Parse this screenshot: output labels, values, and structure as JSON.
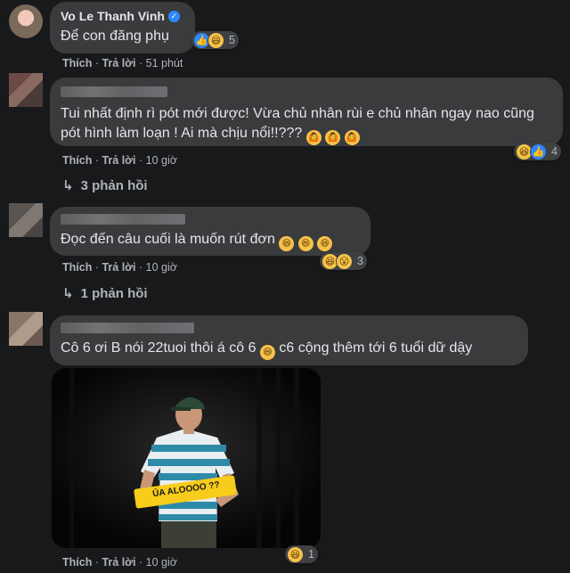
{
  "comments": [
    {
      "author": "Vo Le Thanh Vinh",
      "text": "Để con đăng phụ",
      "reaction_count": "5",
      "actions": {
        "like": "Thích",
        "reply": "Trả lời",
        "time": "51 phút"
      }
    },
    {
      "text": "Tui nhất định rì pót mới được! Vừa chủ nhân rùi e chủ nhân ngay nao cũng pót hình làm loạn ! Ai mà chịu nổi!!???",
      "reaction_count": "4",
      "actions": {
        "like": "Thích",
        "reply": "Trả lời",
        "time": "10 giờ"
      },
      "replies": "3 phản hồi"
    },
    {
      "text": "Đọc đến câu cuối là muốn rút đơn",
      "reaction_count": "3",
      "actions": {
        "like": "Thích",
        "reply": "Trả lời",
        "time": "10 giờ"
      },
      "replies": "1 phản hồi"
    },
    {
      "text_before": "Cô 6 ơi B nói 22tuoi thôi á cô 6",
      "text_after": "c6 cộng thêm tới 6 tuổi dữ dậy",
      "photo_sign": "ÚA ALOOOO ??",
      "reaction_count": "1",
      "actions": {
        "like": "Thích",
        "reply": "Trả lời",
        "time": "10 giờ"
      }
    }
  ],
  "icons": {
    "verified": "verified-badge-icon",
    "like": "like-reaction-icon",
    "haha": "haha-reaction-icon",
    "wow": "wow-reaction-icon",
    "reply_arrow": "reply-arrow-icon"
  },
  "colors": {
    "background": "#18191a",
    "bubble": "#3a3b3c",
    "text": "#e4e6eb",
    "muted": "#b0b3b8",
    "like": "#2d88ff"
  }
}
